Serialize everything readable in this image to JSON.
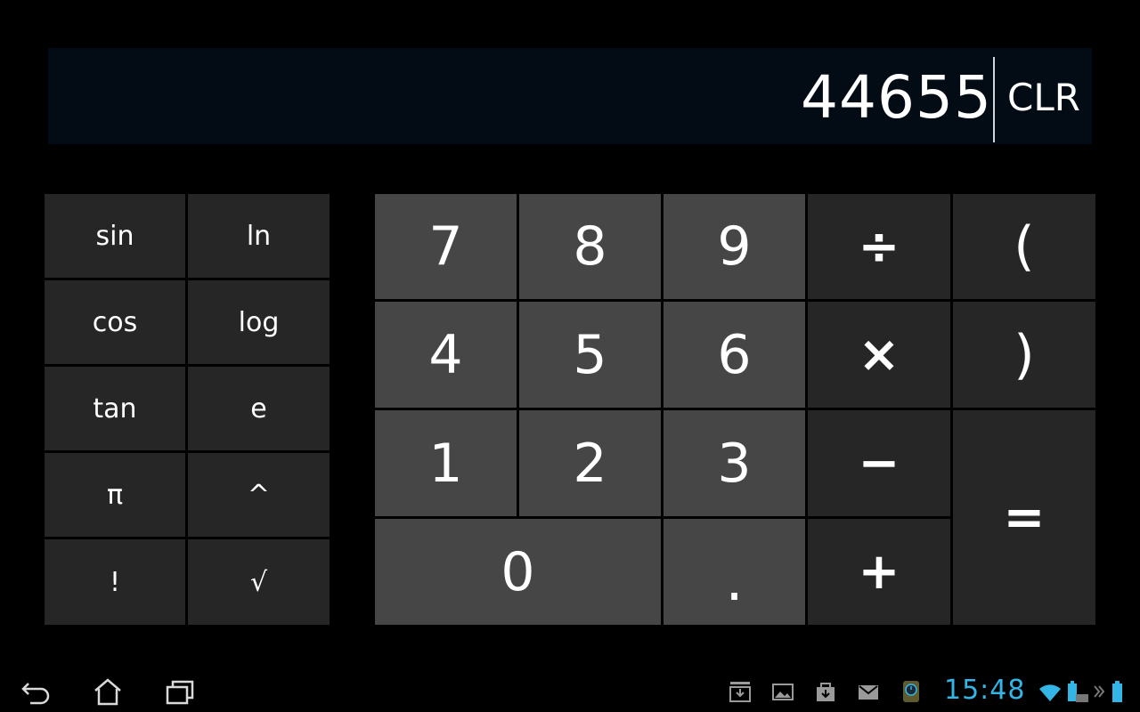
{
  "display": {
    "value": "44655",
    "clear_label": "CLR"
  },
  "advanced_keys": [
    [
      "sin",
      "ln"
    ],
    [
      "cos",
      "log"
    ],
    [
      "tan",
      "e"
    ],
    [
      "π",
      "^"
    ],
    [
      "!",
      "√"
    ]
  ],
  "basic_keys": {
    "seven": "7",
    "eight": "8",
    "nine": "9",
    "four": "4",
    "five": "5",
    "six": "6",
    "one": "1",
    "two": "2",
    "three": "3",
    "zero": "0",
    "point": ".",
    "divide": "÷",
    "multiply": "×",
    "minus": "−",
    "plus": "+",
    "open_paren": "(",
    "close_paren": ")",
    "equals": "="
  },
  "status_bar": {
    "time": "15:48",
    "accent_color": "#33b5e5",
    "nav_icons": [
      "back-icon",
      "home-icon",
      "recent-apps-icon"
    ],
    "notification_icons": [
      "inbox-icon",
      "gallery-icon",
      "store-icon",
      "gmail-icon",
      "app-notification-icon"
    ],
    "system_icons": [
      "wifi-icon",
      "keyboard-battery-icon",
      "chevron-right-icon",
      "battery-icon"
    ]
  }
}
